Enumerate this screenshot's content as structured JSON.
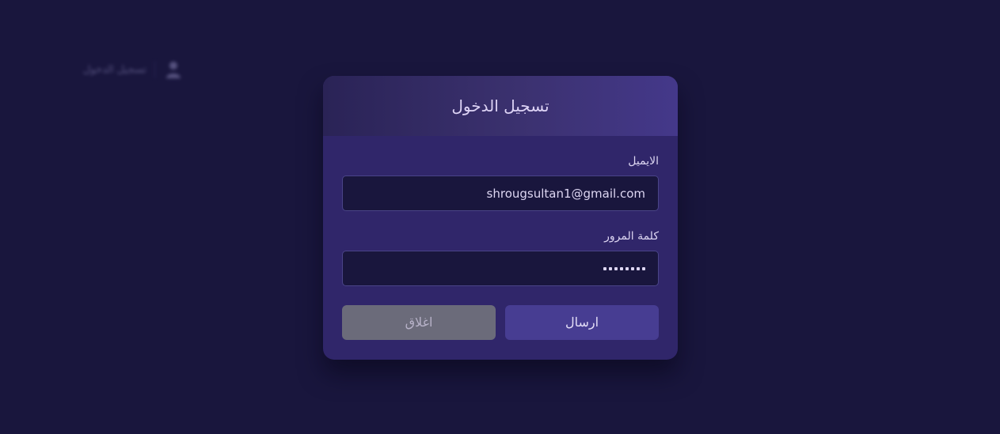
{
  "background_nav": {
    "label": "تسجيل الدخول",
    "icon": "user-icon"
  },
  "modal": {
    "title": "تسجيل الدخول",
    "email": {
      "label": "الايميل",
      "value": "shrougsultan1@gmail.com"
    },
    "password": {
      "label": "كلمة المرور",
      "masked_length": 8
    },
    "buttons": {
      "submit_label": "ارسال",
      "close_label": "اغلاق"
    }
  },
  "colors": {
    "page_background": "#19163d",
    "modal_background": "#30266a",
    "header_gradient_end": "#44388a",
    "input_background": "#19163d",
    "submit_button": "#473d92",
    "close_button": "#6b6b7a",
    "text_light": "#ddd6f2"
  }
}
